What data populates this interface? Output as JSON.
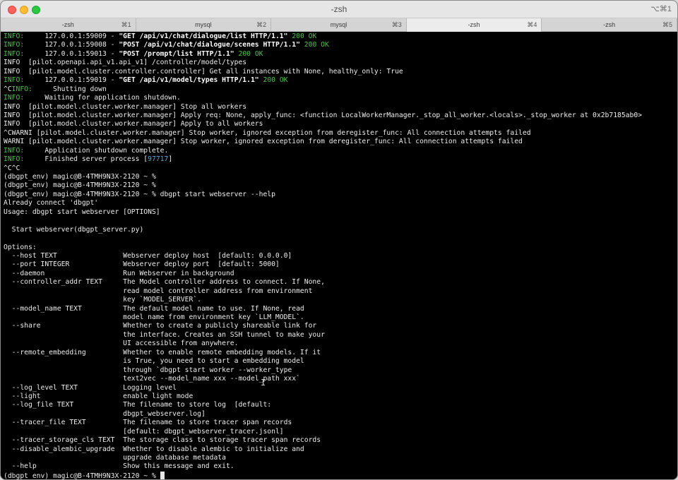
{
  "window": {
    "title": "-zsh",
    "shortcut": "⌥⌘1",
    "colors": {
      "close": "#fe5f57",
      "minimize": "#febc2e",
      "maximize": "#28c840",
      "ok_status": "#3ec93e",
      "pid": "#4aa8d8"
    }
  },
  "tabs": [
    {
      "label": "-zsh",
      "key": "⌘1"
    },
    {
      "label": "mysql",
      "key": "⌘2"
    },
    {
      "label": "mysql",
      "key": "⌘3"
    },
    {
      "label": "-zsh",
      "key": "⌘4"
    },
    {
      "label": "-zsh",
      "key": "⌘5"
    }
  ],
  "terminal": {
    "lines": [
      [
        {
          "t": "INFO:",
          "s": "green"
        },
        {
          "t": "     127.0.0.1:59009 - "
        },
        {
          "t": "\"GET /api/v1/chat/dialogue/list HTTP/1.1\"",
          "s": "bold"
        },
        {
          "t": " "
        },
        {
          "t": "200 OK",
          "s": "green"
        }
      ],
      [
        {
          "t": "INFO:",
          "s": "green"
        },
        {
          "t": "     127.0.0.1:59008 - "
        },
        {
          "t": "\"POST /api/v1/chat/dialogue/scenes HTTP/1.1\"",
          "s": "bold"
        },
        {
          "t": " "
        },
        {
          "t": "200 OK",
          "s": "green"
        }
      ],
      [
        {
          "t": "INFO:",
          "s": "green"
        },
        {
          "t": "     127.0.0.1:59013 - "
        },
        {
          "t": "\"POST /prompt/list HTTP/1.1\"",
          "s": "bold"
        },
        {
          "t": " "
        },
        {
          "t": "200 OK",
          "s": "green"
        }
      ],
      [
        {
          "t": "INFO  [pilot.openapi.api_v1.api_v1] /controller/model/types"
        }
      ],
      [
        {
          "t": "INFO  [pilot.model.cluster.controller.controller] Get all instances with None, healthy_only: True"
        }
      ],
      [
        {
          "t": "INFO:",
          "s": "green"
        },
        {
          "t": "     127.0.0.1:59019 - "
        },
        {
          "t": "\"GET /api/v1/model/types HTTP/1.1\"",
          "s": "bold"
        },
        {
          "t": " "
        },
        {
          "t": "200 OK",
          "s": "green"
        }
      ],
      [
        {
          "t": "^C"
        },
        {
          "t": "INFO:",
          "s": "green"
        },
        {
          "t": "     Shutting down"
        }
      ],
      [
        {
          "t": "INFO:",
          "s": "green"
        },
        {
          "t": "     Waiting for application shutdown."
        }
      ],
      [
        {
          "t": "INFO  [pilot.model.cluster.worker.manager] Stop all workers"
        }
      ],
      [
        {
          "t": "INFO  [pilot.model.cluster.worker.manager] Apply req: None, apply_func: <function LocalWorkerManager._stop_all_worker.<locals>._stop_worker at 0x2b7185ab0>"
        }
      ],
      [
        {
          "t": "INFO  [pilot.model.cluster.worker.manager] Apply to all workers"
        }
      ],
      [
        {
          "t": "^CWARNI [pilot.model.cluster.worker.manager] Stop worker, ignored exception from deregister_func: All connection attempts failed"
        }
      ],
      [
        {
          "t": "WARNI [pilot.model.cluster.worker.manager] Stop worker, ignored exception from deregister_func: All connection attempts failed"
        }
      ],
      [
        {
          "t": "INFO:",
          "s": "green"
        },
        {
          "t": "     Application shutdown complete."
        }
      ],
      [
        {
          "t": "INFO:",
          "s": "green"
        },
        {
          "t": "     Finished server process ["
        },
        {
          "t": "97717",
          "s": "blue"
        },
        {
          "t": "]"
        }
      ],
      [
        {
          "t": "^C^C"
        }
      ],
      [
        {
          "t": "(dbgpt_env) magic@B-4TMH9N3X-2120 ~ %"
        }
      ],
      [
        {
          "t": "(dbgpt_env) magic@B-4TMH9N3X-2120 ~ %"
        }
      ],
      [
        {
          "t": "(dbgpt_env) magic@B-4TMH9N3X-2120 ~ % dbgpt start webserver --help"
        }
      ],
      [
        {
          "t": "Already connect 'dbgpt'"
        }
      ],
      [
        {
          "t": "Usage: dbgpt start webserver [OPTIONS]"
        }
      ],
      [
        {
          "t": ""
        }
      ],
      [
        {
          "t": "  Start webserver(dbgpt_server.py)"
        }
      ],
      [
        {
          "t": ""
        }
      ],
      [
        {
          "t": "Options:"
        }
      ],
      [
        {
          "t": "  --host TEXT                Webserver deploy host  [default: 0.0.0.0]"
        }
      ],
      [
        {
          "t": "  --port INTEGER             Webserver deploy port  [default: 5000]"
        }
      ],
      [
        {
          "t": "  --daemon                   Run Webserver in background"
        }
      ],
      [
        {
          "t": "  --controller_addr TEXT     The Model controller address to connect. If None,"
        }
      ],
      [
        {
          "t": "                             read model controller address from environment"
        }
      ],
      [
        {
          "t": "                             key `MODEL_SERVER`."
        }
      ],
      [
        {
          "t": "  --model_name TEXT          The default model name to use. If None, read"
        }
      ],
      [
        {
          "t": "                             model name from environment key `LLM_MODEL`."
        }
      ],
      [
        {
          "t": "  --share                    Whether to create a publicly shareable link for"
        }
      ],
      [
        {
          "t": "                             the interface. Creates an SSH tunnel to make your"
        }
      ],
      [
        {
          "t": "                             UI accessible from anywhere."
        }
      ],
      [
        {
          "t": "  --remote_embedding         Whether to enable remote embedding models. If it"
        }
      ],
      [
        {
          "t": "                             is True, you need to start a embedding model"
        }
      ],
      [
        {
          "t": "                             through `dbgpt start worker --worker_type"
        }
      ],
      [
        {
          "t": "                             text2vec --model_name xxx --model_path xxx`"
        }
      ],
      [
        {
          "t": "  --log_level TEXT           Logging level"
        }
      ],
      [
        {
          "t": "  --light                    enable light mode"
        }
      ],
      [
        {
          "t": "  --log_file TEXT            The filename to store log  [default:"
        }
      ],
      [
        {
          "t": "                             dbgpt_webserver.log]"
        }
      ],
      [
        {
          "t": "  --tracer_file TEXT         The filename to store tracer span records"
        }
      ],
      [
        {
          "t": "                             [default: dbgpt_webserver_tracer.jsonl]"
        }
      ],
      [
        {
          "t": "  --tracer_storage_cls TEXT  The storage class to storage tracer span records"
        }
      ],
      [
        {
          "t": "  --disable_alembic_upgrade  Whether to disable alembic to initialize and"
        }
      ],
      [
        {
          "t": "                             upgrade database metadata"
        }
      ],
      [
        {
          "t": "  --help                     Show this message and exit."
        }
      ],
      [
        {
          "t": "(dbgpt_env) magic@B-4TMH9N3X-2120 ~ % "
        }
      ]
    ]
  }
}
